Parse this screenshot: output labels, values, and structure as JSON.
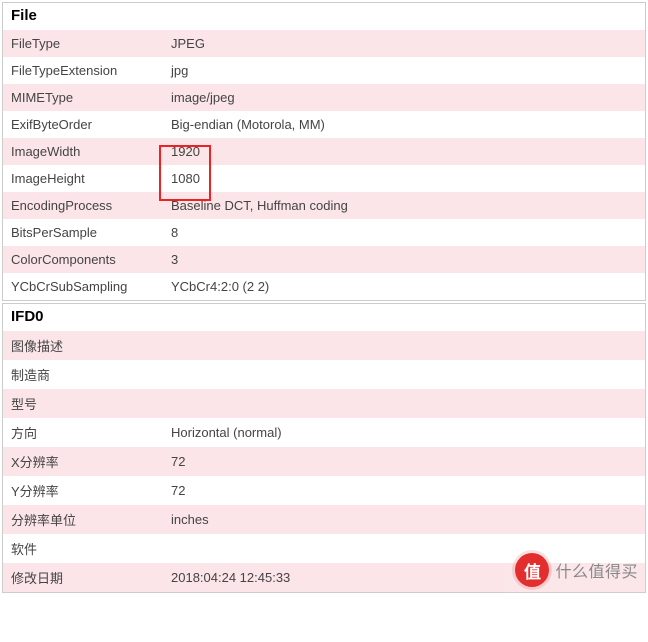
{
  "panels": [
    {
      "title": "File",
      "rows": [
        {
          "key": "FileType",
          "value": "JPEG"
        },
        {
          "key": "FileTypeExtension",
          "value": "jpg"
        },
        {
          "key": "MIMEType",
          "value": "image/jpeg"
        },
        {
          "key": "ExifByteOrder",
          "value": "Big-endian (Motorola, MM)"
        },
        {
          "key": "ImageWidth",
          "value": "1920"
        },
        {
          "key": "ImageHeight",
          "value": "1080"
        },
        {
          "key": "EncodingProcess",
          "value": "Baseline DCT, Huffman coding"
        },
        {
          "key": "BitsPerSample",
          "value": "8"
        },
        {
          "key": "ColorComponents",
          "value": "3"
        },
        {
          "key": "YCbCrSubSampling",
          "value": "YCbCr4:2:0 (2 2)"
        }
      ]
    },
    {
      "title": "IFD0",
      "rows": [
        {
          "key": "图像描述",
          "value": ""
        },
        {
          "key": "制造商",
          "value": ""
        },
        {
          "key": "型号",
          "value": ""
        },
        {
          "key": "方向",
          "value": "Horizontal (normal)"
        },
        {
          "key": "X分辨率",
          "value": "72"
        },
        {
          "key": "Y分辨率",
          "value": "72"
        },
        {
          "key": "分辨率单位",
          "value": "inches"
        },
        {
          "key": "软件",
          "value": ""
        },
        {
          "key": "修改日期",
          "value": "2018:04:24 12:45:33"
        }
      ]
    }
  ],
  "watermark": {
    "badge": "值",
    "text": "什么值得买"
  }
}
